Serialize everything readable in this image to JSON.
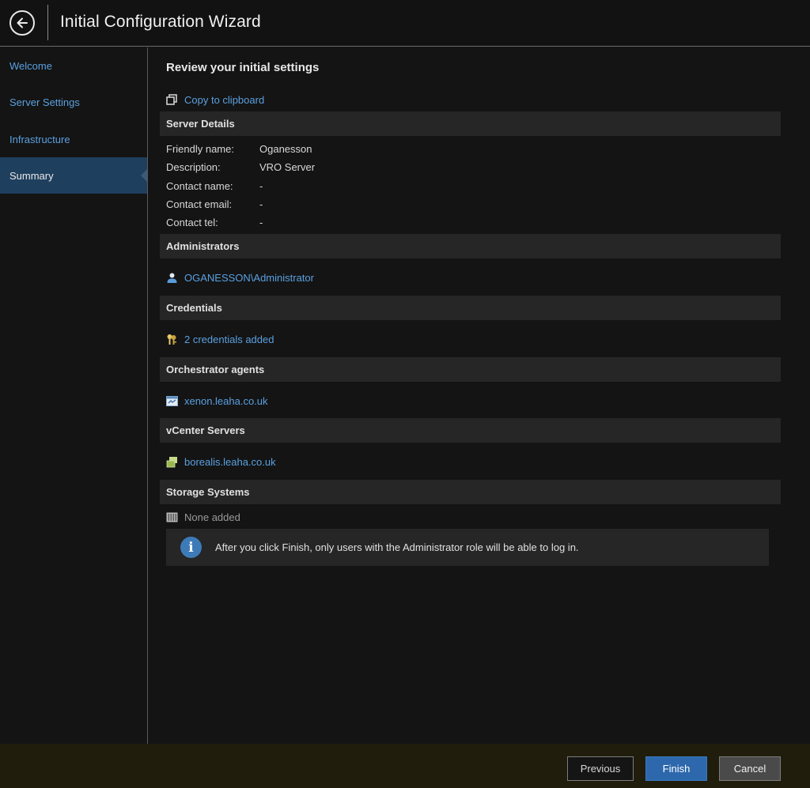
{
  "header": {
    "title": "Initial Configuration Wizard"
  },
  "sidebar": {
    "items": [
      {
        "label": "Welcome"
      },
      {
        "label": "Server Settings"
      },
      {
        "label": "Infrastructure"
      },
      {
        "label": "Summary"
      }
    ],
    "active_index": 3
  },
  "main": {
    "title": "Review your initial settings",
    "copy_label": "Copy to clipboard",
    "server_details": {
      "heading": "Server Details",
      "rows": [
        {
          "label": "Friendly name:",
          "value": "Oganesson"
        },
        {
          "label": "Description:",
          "value": "VRO Server"
        },
        {
          "label": "Contact name:",
          "value": "-"
        },
        {
          "label": "Contact email:",
          "value": "-"
        },
        {
          "label": "Contact tel:",
          "value": "-"
        }
      ]
    },
    "administrators": {
      "heading": "Administrators",
      "item": "OGANESSON\\Administrator"
    },
    "credentials": {
      "heading": "Credentials",
      "item": "2 credentials added"
    },
    "agents": {
      "heading": "Orchestrator agents",
      "item": "xenon.leaha.co.uk"
    },
    "vcenter": {
      "heading": "vCenter Servers",
      "item": "borealis.leaha.co.uk"
    },
    "storage": {
      "heading": "Storage Systems",
      "item": "None added"
    },
    "info": {
      "icon": "i",
      "text": "After you click Finish, only users with the Administrator role will be able to log in."
    }
  },
  "footer": {
    "previous_label": "Previous",
    "finish_label": "Finish",
    "cancel_label": "Cancel"
  },
  "colors": {
    "accent": "#2d68ad",
    "link": "#5aa0e0",
    "active_nav": "#1f3f5e"
  }
}
